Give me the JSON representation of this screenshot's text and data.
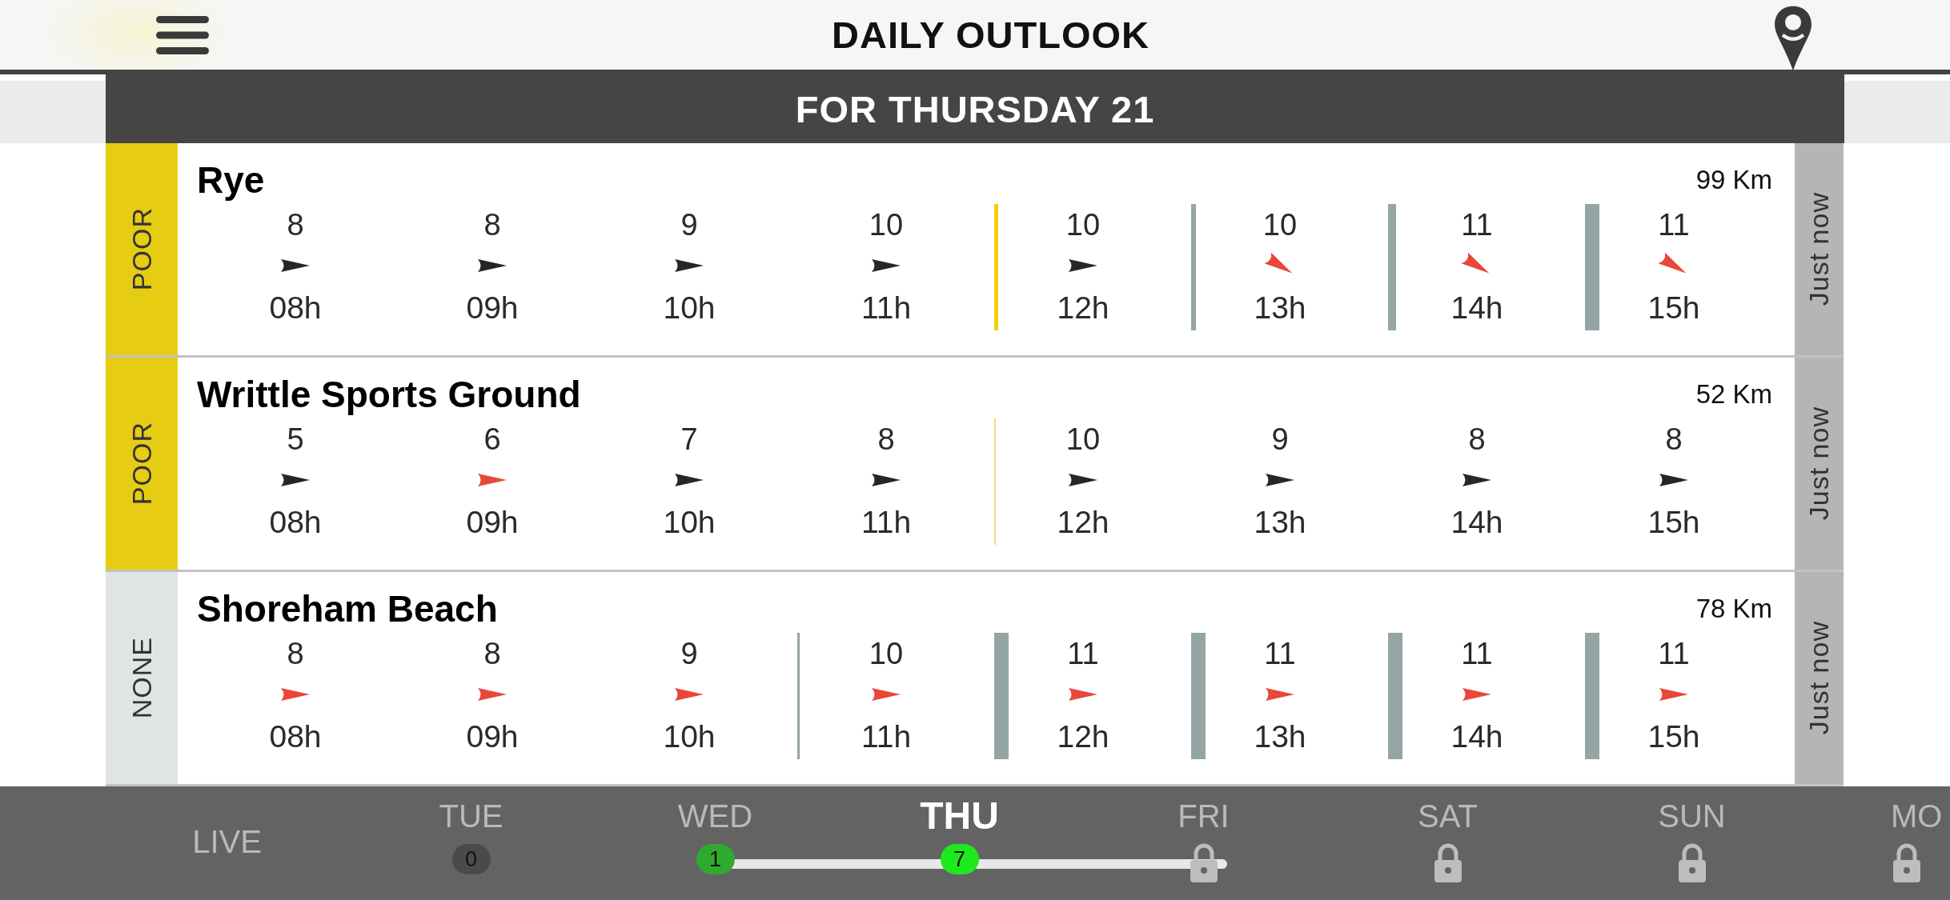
{
  "header": {
    "title": "DAILY OUTLOOK"
  },
  "subheader": {
    "title": "FOR THURSDAY 21"
  },
  "spots": [
    {
      "rating": "POOR",
      "color": "#e6cc12",
      "name": "Rye",
      "distance": "99 Km",
      "updated": "Just now",
      "hours": [
        {
          "speed": "8",
          "hour": "08h",
          "arrow": {
            "color": "#262626",
            "tilted": false
          }
        },
        {
          "speed": "8",
          "hour": "09h",
          "arrow": {
            "color": "#262626",
            "tilted": false
          }
        },
        {
          "speed": "9",
          "hour": "10h",
          "arrow": {
            "color": "#262626",
            "tilted": false
          }
        },
        {
          "speed": "10",
          "hour": "11h",
          "arrow": {
            "color": "#262626",
            "tilted": false
          }
        },
        {
          "speed": "10",
          "hour": "12h",
          "arrow": {
            "color": "#262626",
            "tilted": false
          },
          "marker": {
            "kind": "yellow"
          }
        },
        {
          "speed": "10",
          "hour": "13h",
          "arrow": {
            "color": "#e8473a",
            "tilted": true
          },
          "marker": {
            "kind": "thin"
          }
        },
        {
          "speed": "11",
          "hour": "14h",
          "arrow": {
            "color": "#e8473a",
            "tilted": true
          },
          "marker": {
            "kind": "medium"
          }
        },
        {
          "speed": "11",
          "hour": "15h",
          "arrow": {
            "color": "#e8473a",
            "tilted": true
          },
          "marker": {
            "kind": "thick"
          }
        }
      ]
    },
    {
      "rating": "POOR",
      "color": "#e6cc12",
      "name": "Writtle Sports Ground",
      "distance": "52 Km",
      "updated": "Just now",
      "hours": [
        {
          "speed": "5",
          "hour": "08h",
          "arrow": {
            "color": "#262626",
            "tilted": false
          }
        },
        {
          "speed": "6",
          "hour": "09h",
          "arrow": {
            "color": "#e8473a",
            "tilted": false
          }
        },
        {
          "speed": "7",
          "hour": "10h",
          "arrow": {
            "color": "#262626",
            "tilted": false
          }
        },
        {
          "speed": "8",
          "hour": "11h",
          "arrow": {
            "color": "#262626",
            "tilted": false
          }
        },
        {
          "speed": "10",
          "hour": "12h",
          "arrow": {
            "color": "#262626",
            "tilted": false
          },
          "marker": {
            "kind": "faint"
          }
        },
        {
          "speed": "9",
          "hour": "13h",
          "arrow": {
            "color": "#262626",
            "tilted": false
          }
        },
        {
          "speed": "8",
          "hour": "14h",
          "arrow": {
            "color": "#262626",
            "tilted": false
          }
        },
        {
          "speed": "8",
          "hour": "15h",
          "arrow": {
            "color": "#262626",
            "tilted": false
          }
        }
      ]
    },
    {
      "rating": "NONE",
      "color": "#e1e4e5",
      "name": "Shoreham Beach",
      "distance": "78 Km",
      "updated": "Just now",
      "hours": [
        {
          "speed": "8",
          "hour": "08h",
          "arrow": {
            "color": "#e8473a",
            "tilted": false
          }
        },
        {
          "speed": "8",
          "hour": "09h",
          "arrow": {
            "color": "#e8473a",
            "tilted": false
          }
        },
        {
          "speed": "9",
          "hour": "10h",
          "arrow": {
            "color": "#e8473a",
            "tilted": false
          }
        },
        {
          "speed": "10",
          "hour": "11h",
          "arrow": {
            "color": "#e8473a",
            "tilted": false
          },
          "marker": {
            "kind": "hair"
          }
        },
        {
          "speed": "11",
          "hour": "12h",
          "arrow": {
            "color": "#e8473a",
            "tilted": false
          },
          "marker": {
            "kind": "thick"
          }
        },
        {
          "speed": "11",
          "hour": "13h",
          "arrow": {
            "color": "#e8473a",
            "tilted": false
          },
          "marker": {
            "kind": "thick"
          }
        },
        {
          "speed": "11",
          "hour": "14h",
          "arrow": {
            "color": "#e8473a",
            "tilted": false
          },
          "marker": {
            "kind": "thick"
          }
        },
        {
          "speed": "11",
          "hour": "15h",
          "arrow": {
            "color": "#e8473a",
            "tilted": false
          },
          "marker": {
            "kind": "thick"
          }
        }
      ]
    }
  ],
  "days": [
    {
      "label": "LIVE",
      "selected": false,
      "kind": "live"
    },
    {
      "label": "TUE",
      "selected": false,
      "kind": "count",
      "count": "0",
      "color": "#4a4a4a"
    },
    {
      "label": "WED",
      "selected": false,
      "kind": "count",
      "count": "1",
      "color": "#2faa2f"
    },
    {
      "label": "THU",
      "selected": true,
      "kind": "count",
      "count": "7",
      "color": "#1fe81f"
    },
    {
      "label": "FRI",
      "selected": false,
      "kind": "locked"
    },
    {
      "label": "SAT",
      "selected": false,
      "kind": "locked"
    },
    {
      "label": "SUN",
      "selected": false,
      "kind": "locked"
    },
    {
      "label": "MO",
      "selected": false,
      "kind": "locked"
    }
  ]
}
